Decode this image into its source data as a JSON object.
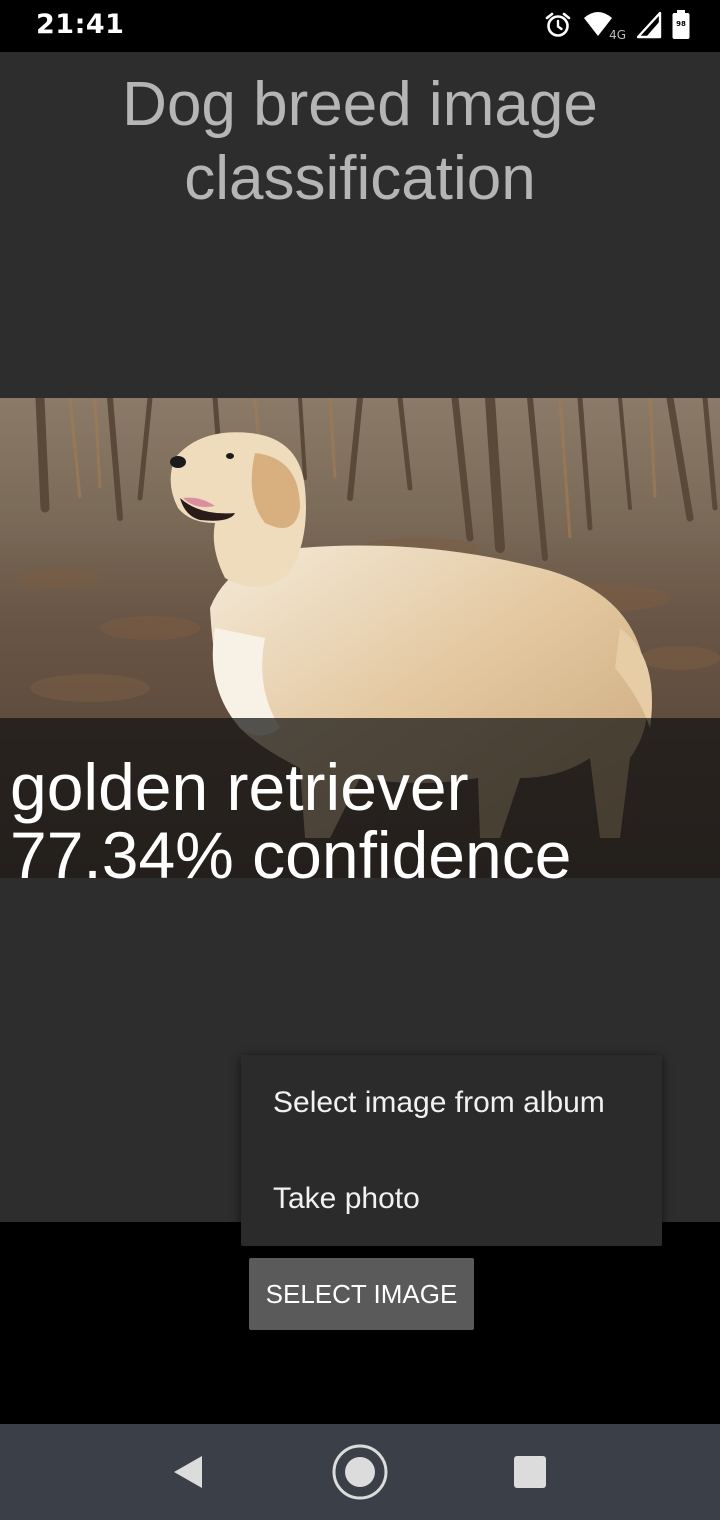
{
  "status_bar": {
    "time": "21:41",
    "network_label": "4G",
    "battery_level": "98",
    "icons": [
      "alarm-icon",
      "wifi-icon",
      "signal-icon",
      "battery-icon"
    ]
  },
  "app": {
    "title": "Dog breed image classification"
  },
  "result": {
    "breed": "golden retriever",
    "confidence": "77.34% confidence"
  },
  "menu": {
    "items": [
      {
        "label": "Select image from album"
      },
      {
        "label": "Take photo"
      }
    ]
  },
  "button": {
    "select_label": "SELECT IMAGE"
  },
  "nav": {
    "icons": [
      "back-icon",
      "home-icon",
      "recents-icon"
    ]
  },
  "colors": {
    "app_background": "#2d2d2d",
    "title_color": "#b5b5b5",
    "button_background": "#5a5a5a",
    "nav_background": "#3b4048"
  }
}
